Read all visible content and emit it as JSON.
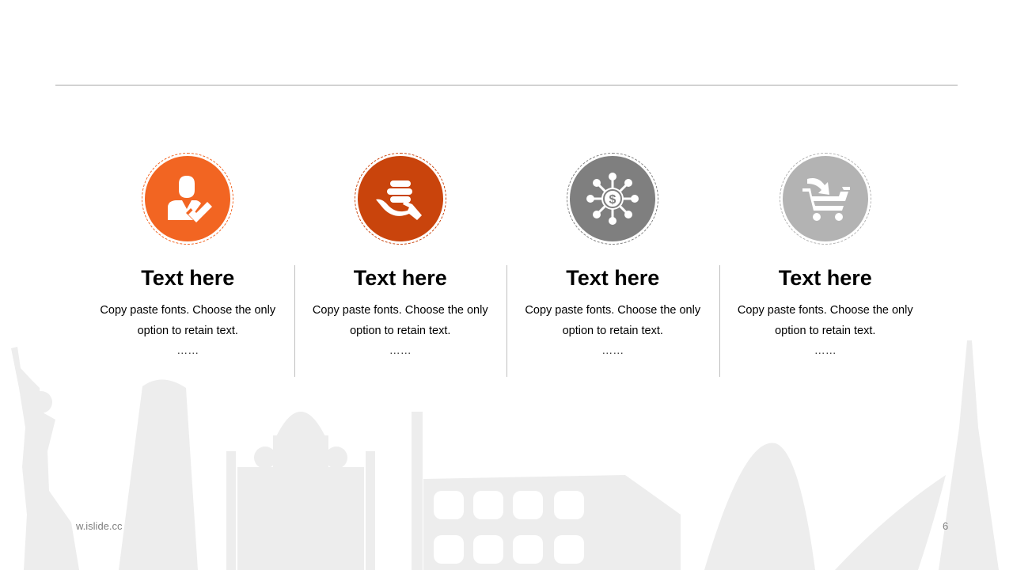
{
  "cards": [
    {
      "title": "Text here",
      "desc": "Copy paste fonts. Choose the only option to retain text.",
      "dots": "……",
      "icon": "businessman-check-icon",
      "color": "#f26522",
      "ring": "#f26522"
    },
    {
      "title": "Text here",
      "desc": "Copy paste fonts. Choose the only option to retain text.",
      "dots": "……",
      "icon": "hand-coins-icon",
      "color": "#c9440c",
      "ring": "#c9440c"
    },
    {
      "title": "Text here",
      "desc": "Copy paste fonts. Choose the only option to retain text.",
      "dots": "……",
      "icon": "dollar-network-icon",
      "color": "#7f7f7f",
      "ring": "#7f7f7f"
    },
    {
      "title": "Text here",
      "desc": "Copy paste fonts. Choose the only option to retain text.",
      "dots": "……",
      "icon": "shopping-cart-icon",
      "color": "#b3b3b3",
      "ring": "#b3b3b3"
    }
  ],
  "footer": {
    "url": "w.islide.cc",
    "page": "6"
  }
}
